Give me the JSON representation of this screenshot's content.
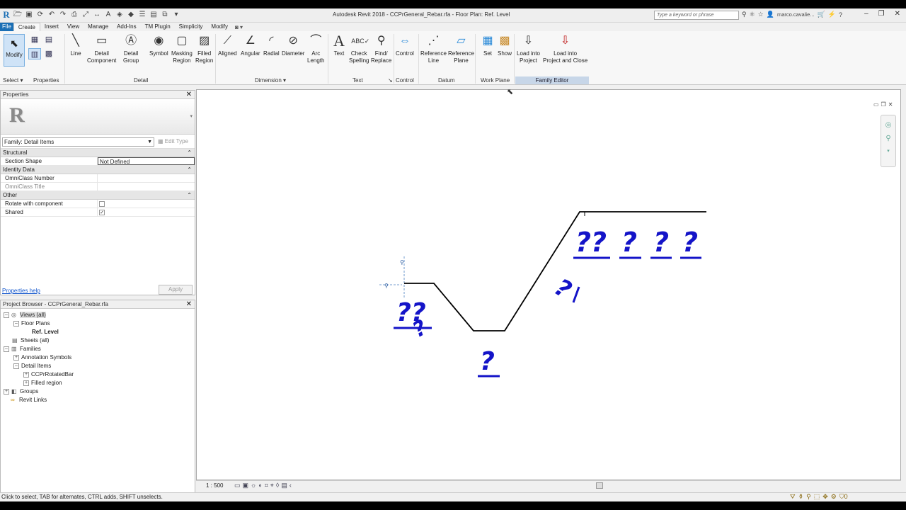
{
  "titlebar": {
    "app_title": "Autodesk Revit 2018 -    CCPrGeneral_Rebar.rfa - Floor Plan: Ref. Level",
    "search_placeholder": "Type a keyword or phrase",
    "user": "marco.cavalie..."
  },
  "tabs": [
    "File",
    "Create",
    "Insert",
    "View",
    "Manage",
    "Add-Ins",
    "TM Plugin",
    "Simplicity",
    "Modify"
  ],
  "ribbon": {
    "modify": "Modify",
    "buttons": {
      "line": "Line",
      "detail_component": [
        "Detail",
        "Component"
      ],
      "detail_group": [
        "Detail",
        "Group"
      ],
      "symbol": "Symbol",
      "masking_region": [
        "Masking",
        "Region"
      ],
      "filled_region": [
        "Filled",
        "Region"
      ],
      "aligned": "Aligned",
      "angular": "Angular",
      "radial": "Radial",
      "diameter": "Diameter",
      "arc_length": [
        "Arc",
        "Length"
      ],
      "text": "Text",
      "check_spelling": [
        "Check",
        "Spelling"
      ],
      "find_replace": [
        "Find/",
        "Replace"
      ],
      "control": "Control",
      "reference_line": [
        "Reference",
        "Line"
      ],
      "reference_plane": [
        "Reference",
        "Plane"
      ],
      "set": "Set",
      "show": "Show",
      "load_into_project": [
        "Load into",
        "Project"
      ],
      "load_into_project_close": [
        "Load into",
        "Project and Close"
      ]
    },
    "panels": {
      "select": "Select",
      "properties": "Properties",
      "detail": "Detail",
      "dimension": "Dimension",
      "text": "Text",
      "control": "Control",
      "datum": "Datum",
      "work_plane": "Work Plane",
      "family_editor": "Family Editor"
    }
  },
  "properties": {
    "title": "Properties",
    "family_select": "Family: Detail Items",
    "edit_type": "Edit Type",
    "categories": {
      "structural": "Structural",
      "identity": "Identity Data",
      "other": "Other"
    },
    "rows": {
      "section_shape": {
        "label": "Section Shape",
        "value": "Not Defined"
      },
      "omniclass_number": {
        "label": "OmniClass Number",
        "value": ""
      },
      "omniclass_title": {
        "label": "OmniClass Title",
        "value": ""
      },
      "rotate_with_component": {
        "label": "Rotate with component",
        "checked": false
      },
      "shared": {
        "label": "Shared",
        "checked": true
      }
    },
    "help_link": "Properties help",
    "apply": "Apply"
  },
  "browser": {
    "title": "Project Browser - CCPrGeneral_Rebar.rfa",
    "nodes": {
      "views": "Views (all)",
      "floor_plans": "Floor Plans",
      "ref_level": "Ref. Level",
      "sheets": "Sheets (all)",
      "families": "Families",
      "annotation_symbols": "Annotation Symbols",
      "detail_items": "Detail Items",
      "ccpr_rotated_bar": "CCPrRotatedBar",
      "filled_region": "Filled region",
      "groups": "Groups",
      "revit_links": "Revit Links"
    }
  },
  "canvas": {
    "labels": {
      "a": "??",
      "b": "?",
      "c": "?",
      "d": "??",
      "e": "?",
      "f": "?",
      "g": "?",
      "h": "?"
    }
  },
  "view_controls": {
    "scale": "1 : 500"
  },
  "status": {
    "text": "Click to select, TAB for alternates, CTRL adds, SHIFT unselects.",
    "filter_count": "0"
  },
  "colors": {
    "accent": "#1b6fb5",
    "annotation": "#1414c8"
  }
}
